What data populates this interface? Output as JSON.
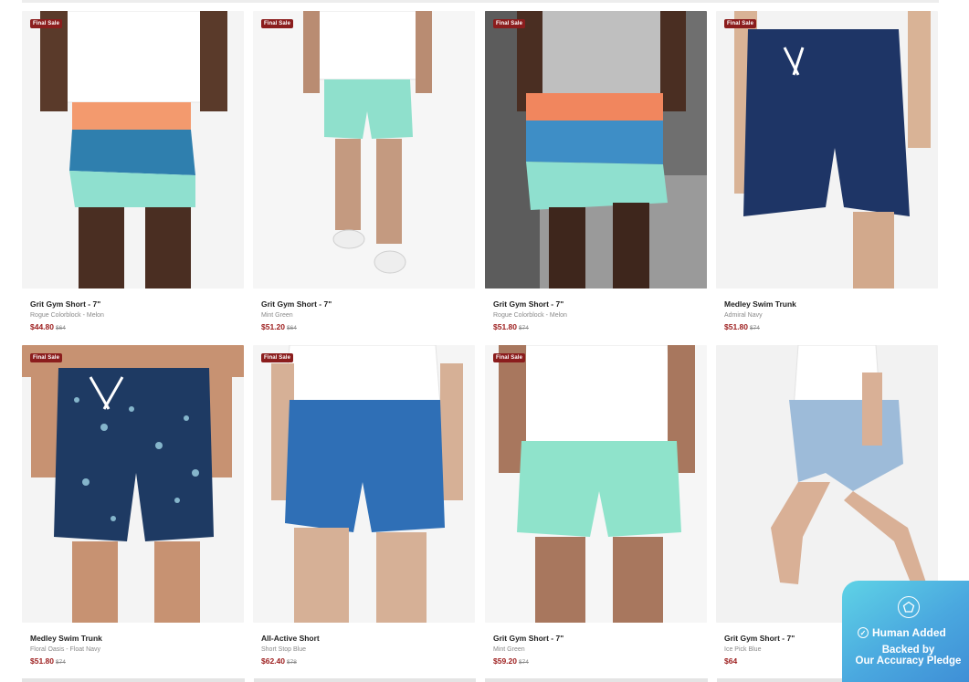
{
  "products": [
    {
      "badge": "Final Sale",
      "title": "Grit Gym Short - 7\"",
      "variant": "Rogue Colorblock - Melon",
      "price": "$44.80",
      "compare": "$64"
    },
    {
      "badge": "Final Sale",
      "title": "Grit Gym Short - 7\"",
      "variant": "Mint Green",
      "price": "$51.20",
      "compare": "$64"
    },
    {
      "badge": "Final Sale",
      "title": "Grit Gym Short - 7\"",
      "variant": "Rogue Colorblock - Melon",
      "price": "$51.80",
      "compare": "$74"
    },
    {
      "badge": "Final Sale",
      "title": "Medley Swim Trunk",
      "variant": "Admiral Navy",
      "price": "$51.80",
      "compare": "$74"
    },
    {
      "badge": "Final Sale",
      "title": "Medley Swim Trunk",
      "variant": "Floral Oasis - Float Navy",
      "price": "$51.80",
      "compare": "$74"
    },
    {
      "badge": "Final Sale",
      "title": "All-Active Short",
      "variant": "Short Stop Blue",
      "price": "$62.40",
      "compare": "$78"
    },
    {
      "badge": "Final Sale",
      "title": "Grit Gym Short - 7\"",
      "variant": "Mint Green",
      "price": "$59.20",
      "compare": "$74"
    },
    {
      "badge": "",
      "title": "Grit Gym Short - 7\"",
      "variant": "Ice Pick Blue",
      "price": "$64",
      "compare": ""
    }
  ],
  "trust_badge": {
    "headline": "Human Added",
    "line1": "Backed by",
    "line2": "Our Accuracy Pledge"
  },
  "colors": {
    "sale_badge": "#8b1d1d",
    "price": "#9c1c1c",
    "trust_badge_start": "#5fd3e6",
    "trust_badge_end": "#3f8fd6"
  }
}
